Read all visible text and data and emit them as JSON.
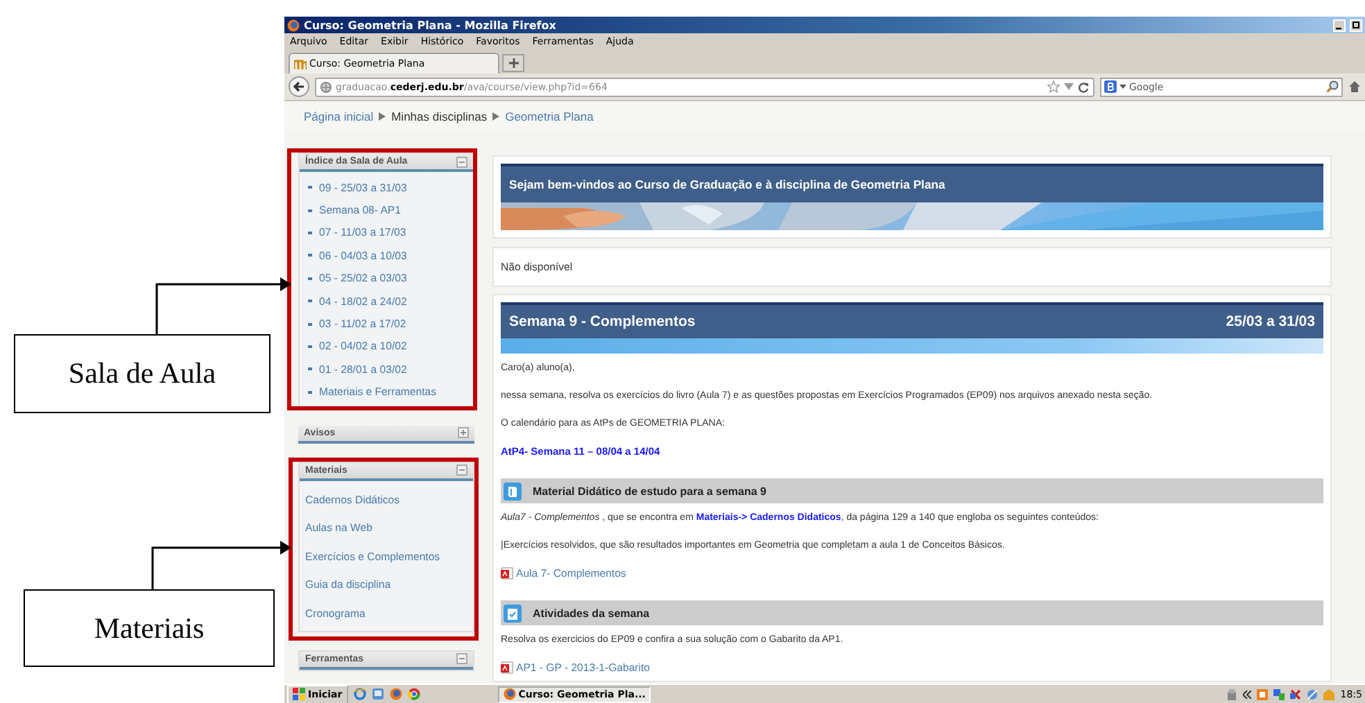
{
  "annotations": [
    {
      "label": "Sala de Aula"
    },
    {
      "label": "Materiais"
    }
  ],
  "window": {
    "title": "Curso: Geometria Plana - Mozilla Firefox"
  },
  "menu": [
    "Arquivo",
    "Editar",
    "Exibir",
    "Histórico",
    "Favoritos",
    "Ferramentas",
    "Ajuda"
  ],
  "tabs": [
    {
      "label": "Curso: Geometria Plana",
      "selected": true
    }
  ],
  "address": {
    "url": "graduacao.**cederj.edu.br**/ava/course/view.php?id=664"
  },
  "search": {
    "placeholder": "Google"
  },
  "breadcrumb": [
    {
      "label": "Página inicial",
      "link": true
    },
    {
      "label": "Minhas disciplinas",
      "link": false
    },
    {
      "label": "Geometria Plana",
      "link": true
    }
  ],
  "sidebar": {
    "blocks": [
      {
        "title": "Índice da Sala de Aula",
        "expanded": true,
        "kind": "bullets",
        "items": [
          "09 - 25/03 a 31/03",
          "Semana 08- AP1",
          "07 - 11/03 a 17/03",
          "06 - 04/03 a 10/03",
          "05 - 25/02 a 03/03",
          "04 - 18/02 a 24/02",
          "03 - 11/02 a 17/02",
          "02 - 04/02 a 10/02",
          "01 - 28/01 a 03/02",
          "Materiais e Ferramentas"
        ]
      },
      {
        "title": "Avisos",
        "expanded": false
      },
      {
        "title": "Materiais",
        "expanded": true,
        "kind": "links",
        "items": [
          "Cadernos Didáticos",
          "Aulas na Web",
          "Exercícios e Complementos",
          "Guia da disciplina",
          "Cronograma"
        ]
      },
      {
        "title": "Ferramentas",
        "expanded": true
      }
    ]
  },
  "main": {
    "banner": {
      "title": "Sejam bem-vindos ao Curso de Graduação e à disciplina de Geometria Plana"
    },
    "notice": "Não disponível",
    "section": {
      "title": "Semana 9 - Complementos",
      "dates": "25/03 a 31/03",
      "content": [
        {
          "kind": "text",
          "text": "Caro(a) aluno(a),"
        },
        {
          "kind": "text",
          "text": "nessa semana, resolva os exercícios do livro (Aula 7) e as questões propostas em Exercícios Programados (EP09) nos arquivos anexado nesta seção."
        },
        {
          "kind": "text",
          "text": "O calendário para as AtPs de GEOMETRIA PLANA:"
        },
        {
          "kind": "highlight",
          "text": "AtP4- Semana 11 – 08/04 a 14/04"
        },
        {
          "kind": "heading",
          "text": "Material Didático de estudo para a semana 9"
        },
        {
          "kind": "text",
          "text": "*Aula7 - Complementos* , que se encontra em **Materiais-> Cadernos Didaticos**, da página 129 a 140  que engloba os seguintes conteúdos:"
        },
        {
          "kind": "text",
          "text": "|Exercícios resolvidos, que são resultados importantes em Geometria que completam a aula 1 de Conceitos Básicos."
        },
        {
          "kind": "file",
          "text": "Aula 7- Complementos"
        },
        {
          "kind": "heading",
          "text": "Atividades da semana"
        },
        {
          "kind": "text",
          "text": "Resolva os  exercicios do EP09  e confira a sua solução com o Gabarito da AP1."
        },
        {
          "kind": "file",
          "text": "AP1 - GP - 2013-1-Gabarito"
        }
      ]
    }
  },
  "taskbar": {
    "start": "Iniciar",
    "task": "Curso: Geometria Pla...",
    "clock": "18:5"
  }
}
